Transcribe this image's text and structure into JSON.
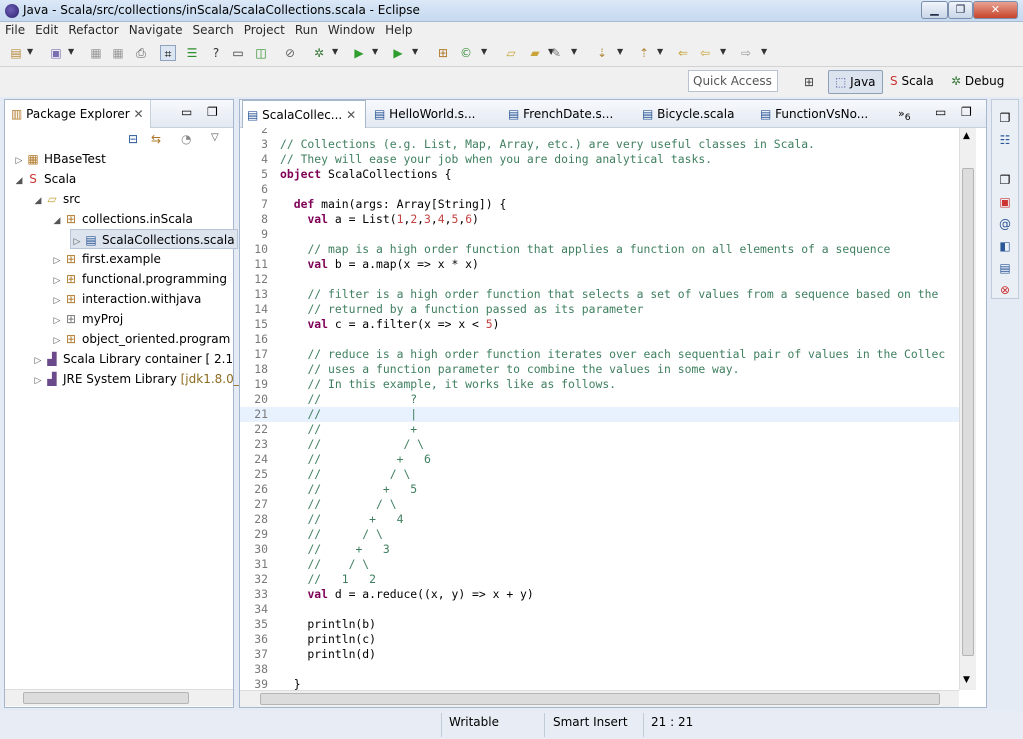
{
  "window": {
    "title": "Java - Scala/src/collections/inScala/ScalaCollections.scala - Eclipse"
  },
  "menu": [
    "File",
    "Edit",
    "Refactor",
    "Navigate",
    "Search",
    "Project",
    "Run",
    "Window",
    "Help"
  ],
  "quick_access": {
    "placeholder": "Quick Access"
  },
  "perspectives": [
    "Java",
    "Scala",
    "Debug"
  ],
  "package_explorer": {
    "title": "Package Explorer",
    "tree": [
      {
        "label": "HBaseTest",
        "icon": "project-icon"
      },
      {
        "label": "Scala",
        "icon": "project-icon"
      },
      {
        "label": "src",
        "icon": "source-folder-icon"
      },
      {
        "label": "collections.inScala",
        "icon": "package-icon"
      },
      {
        "label": "ScalaCollections.scala",
        "icon": "scala-file-icon"
      },
      {
        "label": "first.example",
        "icon": "package-icon"
      },
      {
        "label": "functional.programming",
        "icon": "package-icon"
      },
      {
        "label": "interaction.withjava",
        "icon": "package-icon"
      },
      {
        "label": "myProj",
        "icon": "empty-package-icon"
      },
      {
        "label": "object_oriented.program",
        "icon": "package-icon"
      },
      {
        "label": "Scala Library container [ 2.1",
        "icon": "library-icon"
      },
      {
        "label": "JRE System Library",
        "suffix": "[jdk1.8.0_",
        "icon": "library-icon"
      }
    ]
  },
  "editor": {
    "tabs": [
      "ScalaCollec...",
      "HelloWorld.s...",
      "FrenchDate.s...",
      "Bicycle.scala",
      "FunctionVsNo..."
    ],
    "overflow_count": "6",
    "lines": [
      {
        "n": "2",
        "t": ""
      },
      {
        "n": "3",
        "t": "// Collections (e.g. List, Map, Array, etc.) are very useful classes in Scala."
      },
      {
        "n": "4",
        "t": "// They will ease your job when you are doing analytical tasks."
      },
      {
        "n": "5",
        "t": "object ScalaCollections {"
      },
      {
        "n": "6",
        "t": ""
      },
      {
        "n": "7",
        "t": "  def main(args: Array[String]) {"
      },
      {
        "n": "8",
        "t": "    val a = List(1,2,3,4,5,6)"
      },
      {
        "n": "9",
        "t": ""
      },
      {
        "n": "10",
        "t": "    // map is a high order function that applies a function on all elements of a sequence"
      },
      {
        "n": "11",
        "t": "    val b = a.map(x => x * x)"
      },
      {
        "n": "12",
        "t": ""
      },
      {
        "n": "13",
        "t": "    // filter is a high order function that selects a set of values from a sequence based on the"
      },
      {
        "n": "14",
        "t": "    // returned by a function passed as its parameter"
      },
      {
        "n": "15",
        "t": "    val c = a.filter(x => x < 5)"
      },
      {
        "n": "16",
        "t": ""
      },
      {
        "n": "17",
        "t": "    // reduce is a high order function iterates over each sequential pair of values in the Collec"
      },
      {
        "n": "18",
        "t": "    // uses a function parameter to combine the values in some way."
      },
      {
        "n": "19",
        "t": "    // In this example, it works like as follows."
      },
      {
        "n": "20",
        "t": "    //             ?"
      },
      {
        "n": "21",
        "t": "    //             |"
      },
      {
        "n": "22",
        "t": "    //             +"
      },
      {
        "n": "23",
        "t": "    //            / \\"
      },
      {
        "n": "24",
        "t": "    //           +   6"
      },
      {
        "n": "25",
        "t": "    //          / \\"
      },
      {
        "n": "26",
        "t": "    //         +   5"
      },
      {
        "n": "27",
        "t": "    //        / \\"
      },
      {
        "n": "28",
        "t": "    //       +   4"
      },
      {
        "n": "29",
        "t": "    //      / \\"
      },
      {
        "n": "30",
        "t": "    //     +   3"
      },
      {
        "n": "31",
        "t": "    //    / \\"
      },
      {
        "n": "32",
        "t": "    //   1   2"
      },
      {
        "n": "33",
        "t": "    val d = a.reduce((x, y) => x + y)"
      },
      {
        "n": "34",
        "t": ""
      },
      {
        "n": "35",
        "t": "    println(b)"
      },
      {
        "n": "36",
        "t": "    println(c)"
      },
      {
        "n": "37",
        "t": "    println(d)"
      },
      {
        "n": "38",
        "t": ""
      },
      {
        "n": "39",
        "t": "  }"
      }
    ]
  },
  "status": {
    "mode": "Writable",
    "insert": "Smart Insert",
    "position": "21 : 21"
  }
}
